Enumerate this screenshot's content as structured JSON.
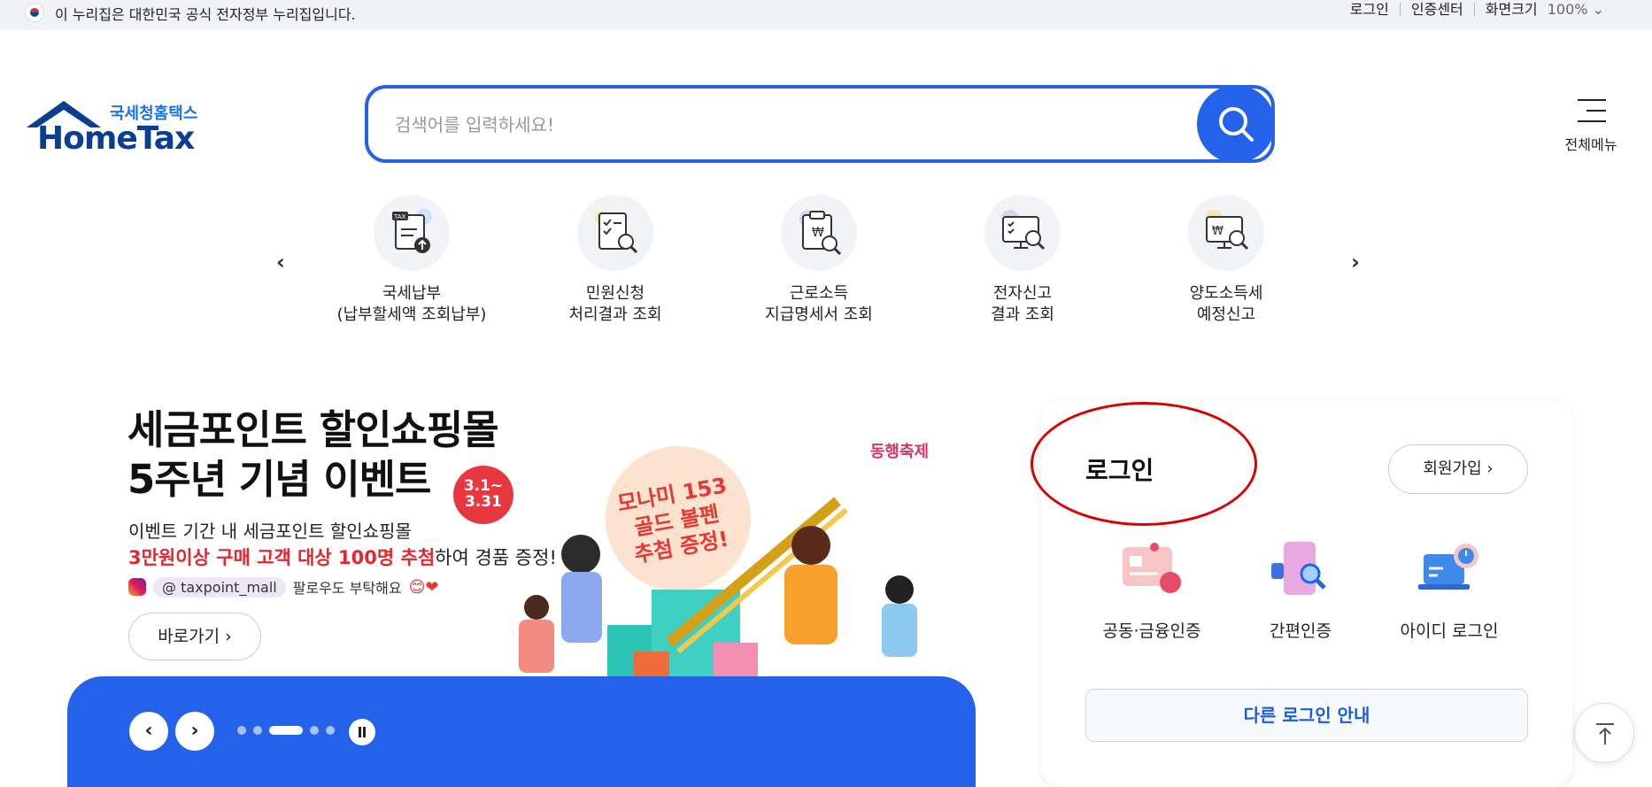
{
  "topbar": {
    "gov_notice": "이 누리집은 대한민국 공식 전자정부 누리집입니다.",
    "login": "로그인",
    "cert_center": "인증센터",
    "zoom_label": "화면크기",
    "zoom_value": "100%"
  },
  "logo": {
    "kr": "국세청홈택스",
    "en": "HomeTax"
  },
  "search": {
    "placeholder": "검색어를 입력하세요!"
  },
  "menu": {
    "all_menu": "전체메뉴"
  },
  "quick_menu": [
    {
      "line1": "국세납부",
      "line2": "(납부할세액 조회납부)",
      "icon": "tax-upload-icon"
    },
    {
      "line1": "민원신청",
      "line2": "처리결과 조회",
      "icon": "document-search-icon"
    },
    {
      "line1": "근로소득",
      "line2": "지급명세서 조회",
      "icon": "clipboard-won-search-icon"
    },
    {
      "line1": "전자신고",
      "line2": "결과 조회",
      "icon": "monitor-checklist-icon"
    },
    {
      "line1": "양도소득세",
      "line2": "예정신고",
      "icon": "monitor-won-search-icon"
    }
  ],
  "banner": {
    "title_line1": "세금포인트 할인쇼핑몰",
    "title_line2": "5주년 기념 이벤트",
    "date_badge": "3.1~\n3.31",
    "desc1": "이벤트 기간 내 세금포인트 할인쇼핑몰",
    "desc2_red": "3만원이상 구매 고객 대상 100명 추첨",
    "desc2_rest": "하여 경품 증정!",
    "sns_handle": "@ taxpoint_mall",
    "sns_text": "팔로우도 부탁해요",
    "go_button": "바로가기",
    "promo_bubble": "모나미 153\n골드 볼펜\n추첨 증정!",
    "festa_logo": "동행축제"
  },
  "login_panel": {
    "title": "로그인",
    "join_button": "회원가입",
    "options": [
      {
        "label": "공동·금융인증",
        "icon": "certificate-card-icon"
      },
      {
        "label": "간편인증",
        "icon": "phone-search-icon"
      },
      {
        "label": "아이디 로그인",
        "icon": "laptop-power-icon"
      }
    ],
    "other_login": "다른 로그인 안내"
  },
  "colors": {
    "primary": "#2463e9",
    "logo_navy": "#0b3d91",
    "accent_red": "#e5262c"
  }
}
